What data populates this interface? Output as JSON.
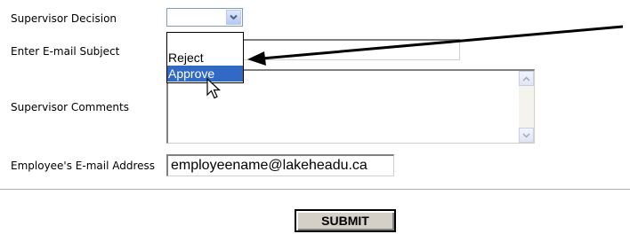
{
  "form": {
    "decision_label": "Supervisor Decision",
    "subject_label": "Enter E-mail Subject",
    "comments_label": "Supervisor Comments",
    "email_label": "Employee's E-mail Address",
    "decision_value": "",
    "decision_options": [
      "",
      "Reject",
      "Approve"
    ],
    "highlighted_option": "Approve",
    "email_value": "employeename@lakeheadu.ca",
    "submit_label": "SUBMIT"
  },
  "colors": {
    "highlight": "#316ac5",
    "annotation_arrow": "#000000"
  },
  "icons": {
    "select_arrow": "chevron-down-icon",
    "scroll_up": "scroll-up-icon",
    "scroll_down": "scroll-down-icon",
    "pointer": "mouse-pointer-icon"
  }
}
